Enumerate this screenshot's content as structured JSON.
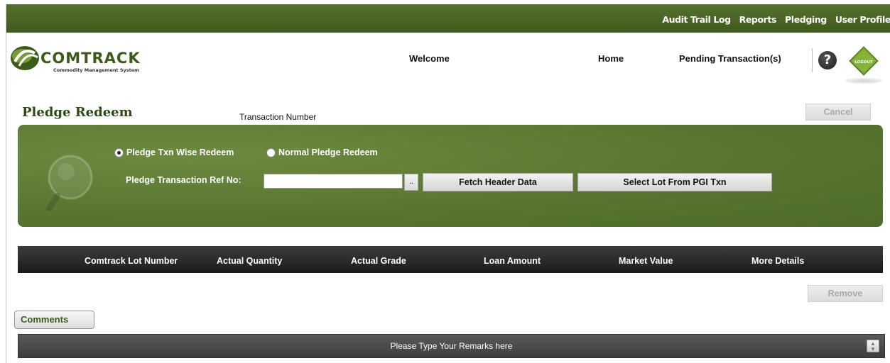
{
  "top_nav": {
    "items": [
      {
        "label": "Audit Trail Log"
      },
      {
        "label": "Reports"
      },
      {
        "label": "Pledging"
      },
      {
        "label": "User Profile"
      }
    ]
  },
  "header": {
    "logo_text": "COMTRACK",
    "logo_tagline": "Commodity Management System",
    "welcome": "Welcome",
    "home": "Home",
    "pending": "Pending Transaction(s)",
    "help_icon": "?",
    "logout_icon_text": "LOGOUT"
  },
  "page": {
    "title": "Pledge Redeem",
    "txn_number_label": "Transaction Number",
    "cancel_label": "Cancel"
  },
  "filter": {
    "radio_txn_wise": "Pledge Txn Wise Redeem",
    "radio_normal": "Normal Pledge Redeem",
    "selected": "Pledge Txn Wise Redeem",
    "ref_label": "Pledge Transaction Ref No:",
    "ref_value": "",
    "lookup_label": "..",
    "fetch_label": "Fetch Header Data",
    "select_lot_label": "Select Lot From PGI Txn"
  },
  "table": {
    "columns": [
      "Comtrack Lot Number",
      "Actual Quantity",
      "Actual Grade",
      "Loan Amount",
      "Market Value",
      "More Details"
    ],
    "rows": [],
    "remove_label": "Remove"
  },
  "comments": {
    "button_label": "Comments",
    "placeholder": "Please Type Your Remarks here"
  },
  "colors": {
    "brand_green": "#4e6b2a",
    "table_header": "#1b1b1b"
  }
}
